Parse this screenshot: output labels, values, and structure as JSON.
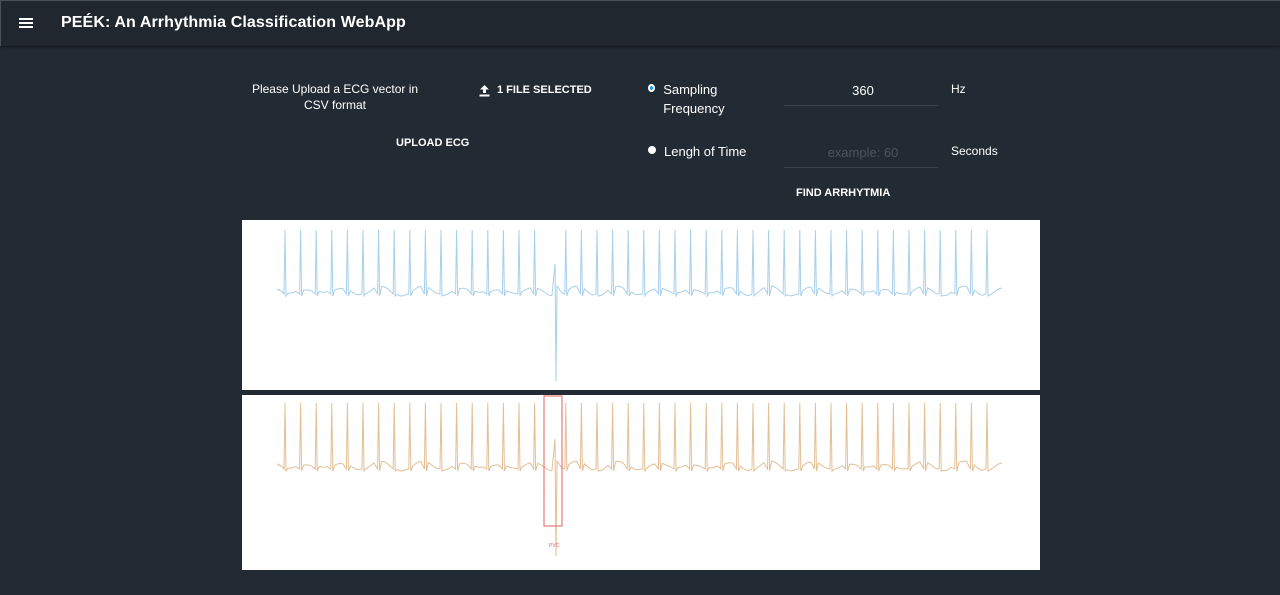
{
  "appbar": {
    "title": "PEÉK: An Arrhythmia Classification WebApp"
  },
  "upload": {
    "prompt": "Please Upload a ECG vector in CSV format",
    "file_button_label": "1 FILE SELECTED",
    "upload_button_label": "UPLOAD ECG"
  },
  "options": {
    "sampling_frequency": {
      "label": "Sampling Frequency",
      "value": "360",
      "unit": "Hz",
      "selected": true
    },
    "length_of_time": {
      "label": "Lengh of Time",
      "placeholder": "example: 60",
      "unit": "Seconds",
      "selected": false
    },
    "find_button_label": "FIND ARRHYTMIA"
  },
  "charts": {
    "raw_color": "#a9cfe9",
    "classified_color": "#e2bf95",
    "highlight_color": "#e06060",
    "highlight_label": "PVC"
  },
  "icons": {
    "menu": "menu-icon",
    "upload": "upload-icon"
  }
}
